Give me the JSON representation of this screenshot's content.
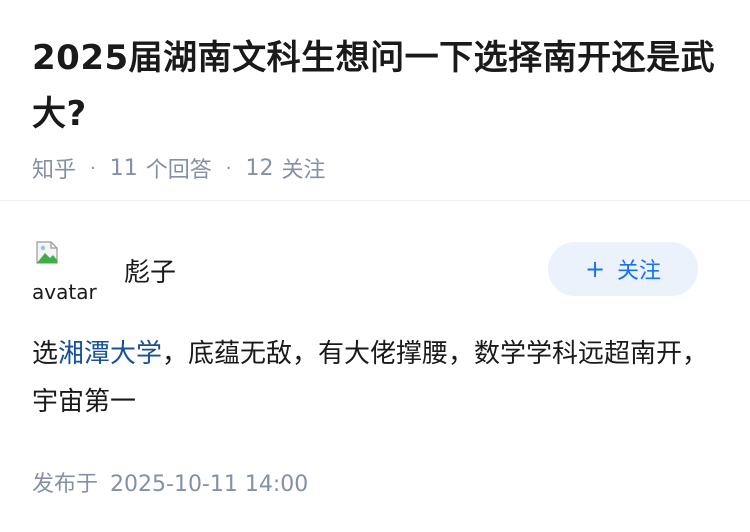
{
  "question": {
    "title": "2025届湖南文科生想问一下选择南开还是武大?",
    "source": "知乎",
    "separator": "·",
    "answer_count": "11",
    "answer_label": "个回答",
    "follow_count": "12",
    "follow_label": "关注"
  },
  "answer": {
    "avatar_alt": "avatar",
    "author_name": "彪子",
    "follow_button": {
      "icon": "+",
      "label": "关注"
    },
    "body": {
      "prefix": "选",
      "link_text": "湘潭大学",
      "suffix": "，底蕴无敌，有大佬撑腰，数学学科远超南开，宇宙第一"
    },
    "publish_label": "发布于",
    "publish_time": "2025-10-11 14:00"
  },
  "colors": {
    "link": "#175199",
    "accent": "#1772f6",
    "follow_bg": "#ebf2fb",
    "meta": "#8590a6"
  }
}
